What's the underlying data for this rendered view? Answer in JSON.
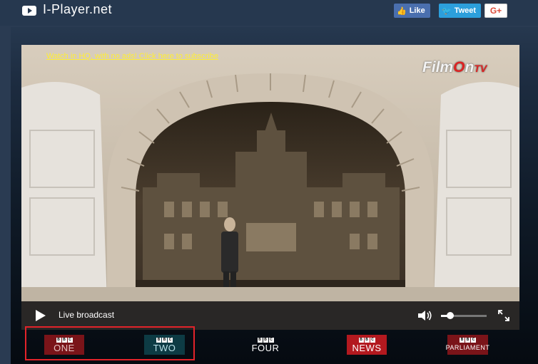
{
  "header": {
    "site_title": "I-Player.net",
    "logo_icon": "youtube-play-icon",
    "social": {
      "facebook_label": "Like",
      "twitter_label": "Tweet",
      "gplus_label": "G+"
    }
  },
  "player": {
    "subscribe_text": "Watch in HQ, with no ads! Click here to subscribe",
    "watermark": "FilmOn TV",
    "status_text": "Live broadcast",
    "volume_level": 0.2
  },
  "channels": [
    {
      "bbc": "BBC",
      "name": "ONE"
    },
    {
      "bbc": "BBC",
      "name": "TWO"
    },
    {
      "bbc": "BBC",
      "name": "FOUR"
    },
    {
      "bbc": "BBC",
      "name": "NEWS"
    },
    {
      "bbc": "BBC",
      "name": "PARLIAMENT"
    }
  ],
  "colors": {
    "accent_highlight": "#e2232a",
    "subscribe_link": "#ffee33",
    "facebook": "#4a6fae",
    "twitter": "#2c9fdc"
  }
}
